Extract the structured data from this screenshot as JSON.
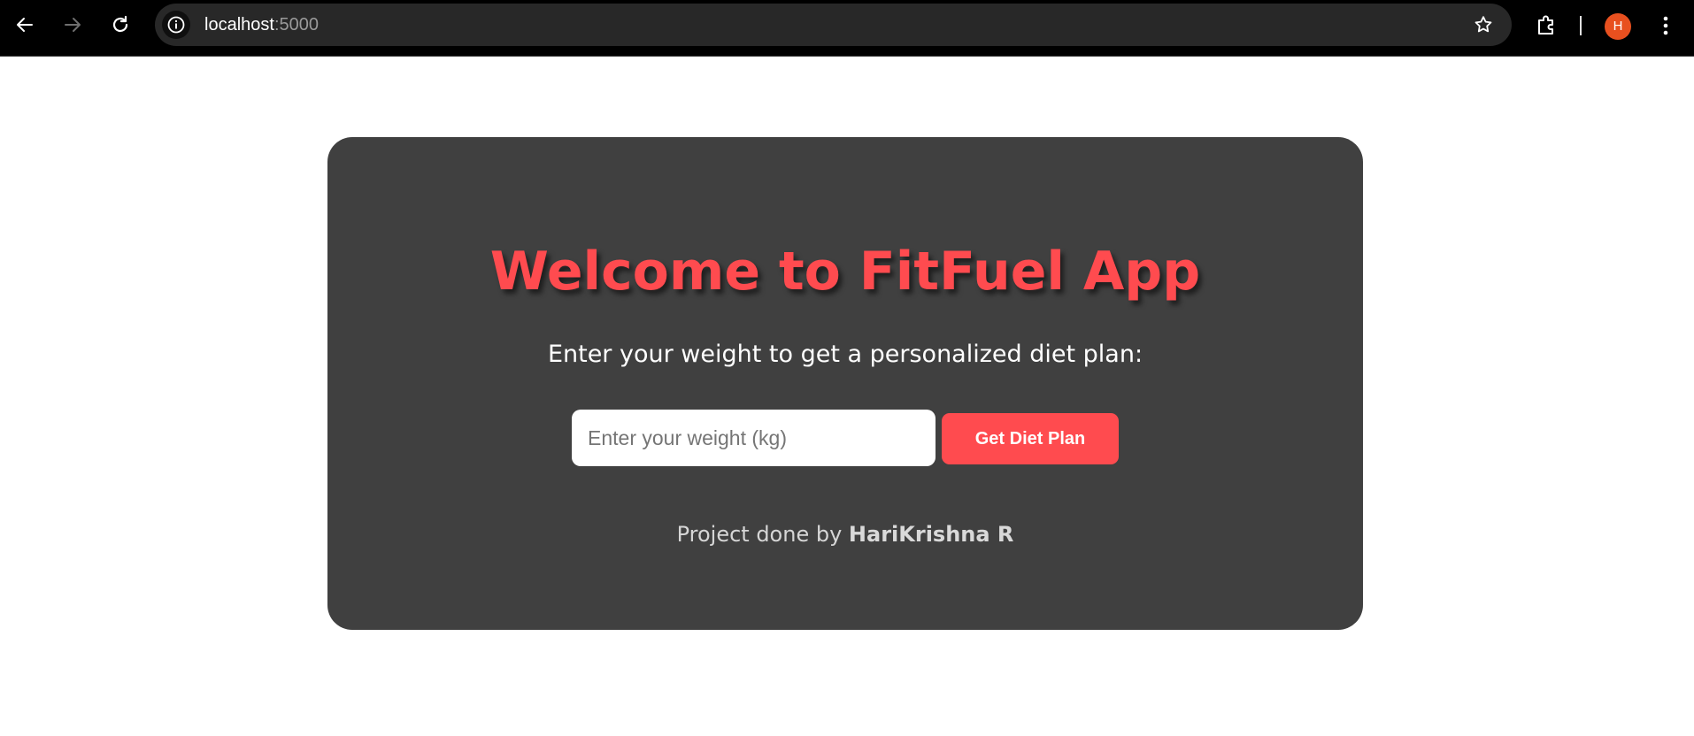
{
  "browser": {
    "url_host": "localhost",
    "url_port": ":5000",
    "profile_initial": "H",
    "icons": {
      "back": "arrow-left-icon",
      "forward": "arrow-right-icon",
      "reload": "reload-icon",
      "site_info": "info-icon",
      "bookmark": "star-icon",
      "extensions": "puzzle-icon",
      "menu": "more-vertical-icon"
    }
  },
  "page": {
    "title": "Welcome to FitFuel App",
    "subtitle": "Enter your weight to get a personalized diet plan:",
    "weight_input": {
      "value": "",
      "placeholder": "Enter your weight (kg)"
    },
    "submit_label": "Get Diet Plan",
    "credit_prefix": "Project done by ",
    "credit_name": "HariKrishna R"
  },
  "colors": {
    "accent": "#ff4b4f",
    "card_background": "#404040",
    "page_background": "#ffffff",
    "avatar": "#e8501f"
  }
}
